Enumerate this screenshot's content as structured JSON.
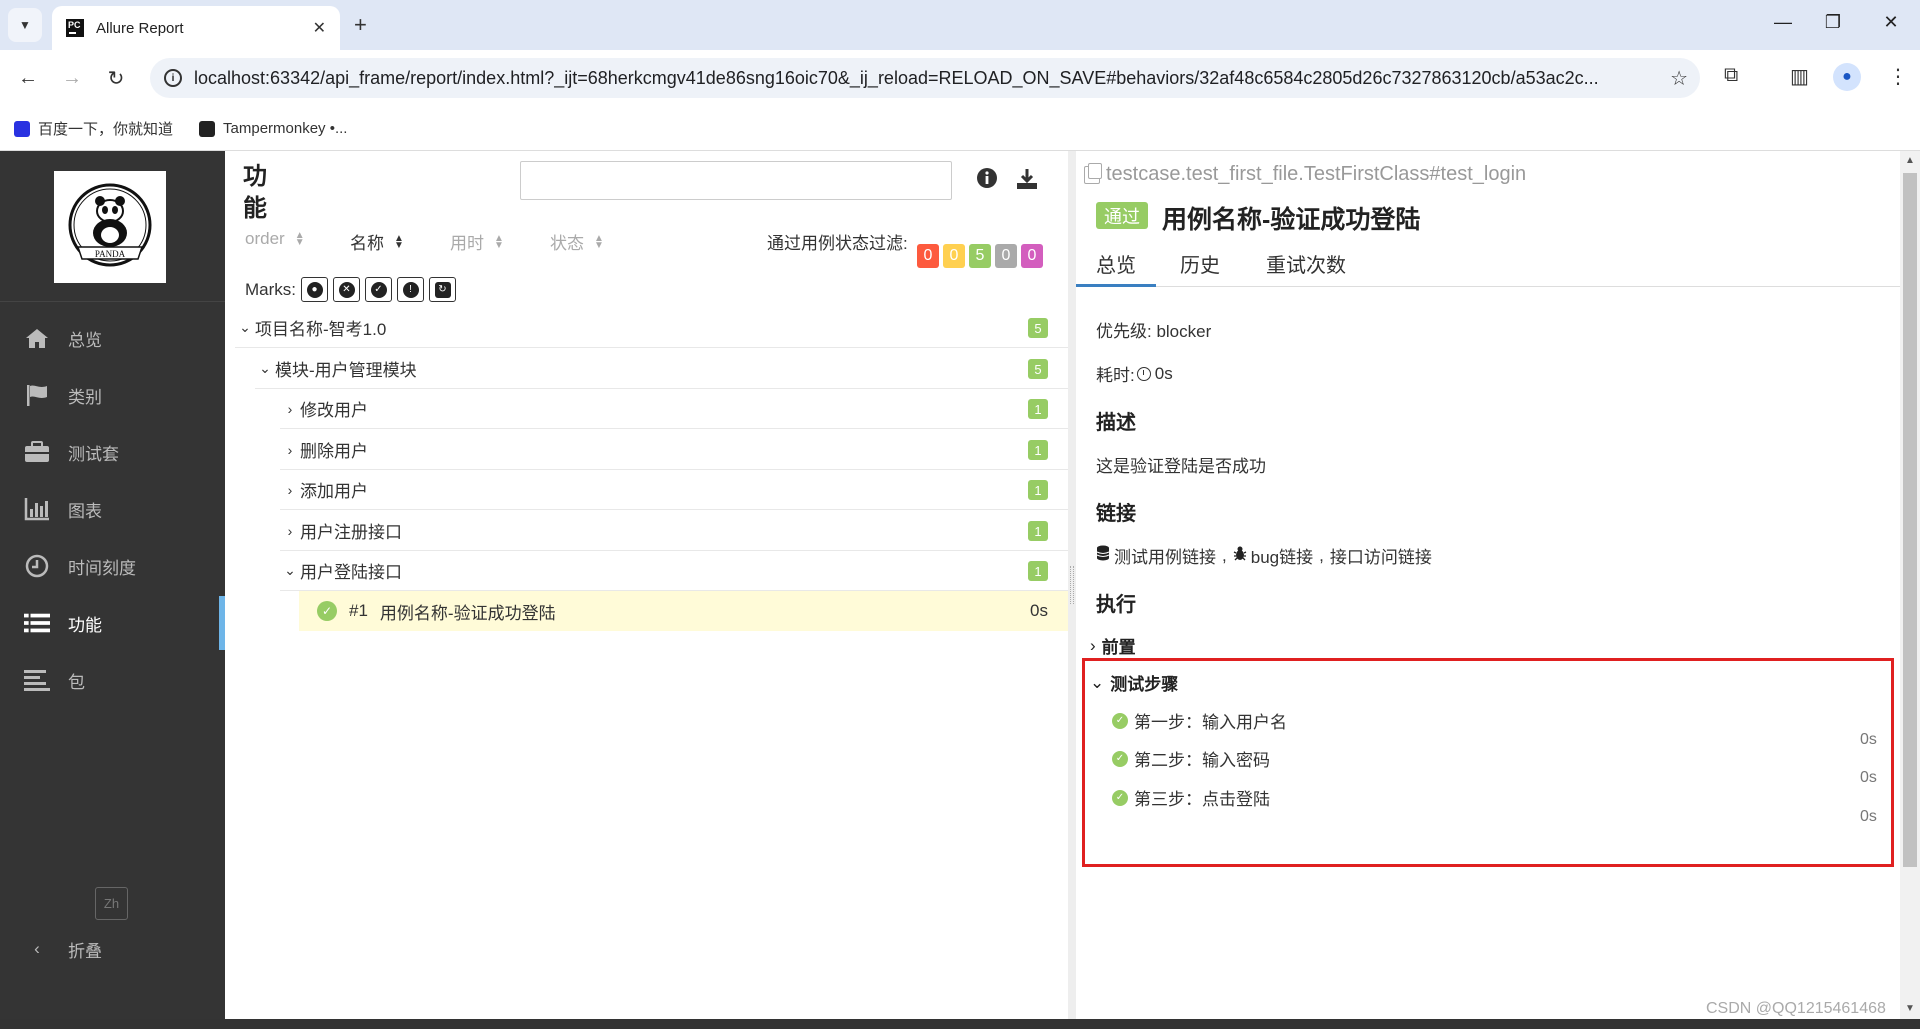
{
  "browser": {
    "tab_title": "Allure Report",
    "favicon_text": "PC",
    "url": "localhost:63342/api_frame/report/index.html?_ijt=68herkcmgv41de86sng16oic70&_ij_reload=RELOAD_ON_SAVE#behaviors/32af48c6584c2805d26c7327863120cb/a53ac2c...",
    "bookmarks": [
      "百度一下，你就知道",
      "Tampermonkey •..."
    ]
  },
  "sidebar": {
    "items": [
      {
        "label": "总览",
        "icon": "home-icon"
      },
      {
        "label": "类别",
        "icon": "flag-icon"
      },
      {
        "label": "测试套",
        "icon": "briefcase-icon"
      },
      {
        "label": "图表",
        "icon": "bar-chart-icon"
      },
      {
        "label": "时间刻度",
        "icon": "clock-icon"
      },
      {
        "label": "功能",
        "icon": "list-icon",
        "active": true
      },
      {
        "label": "包",
        "icon": "align-left-icon"
      }
    ],
    "lang": "Zh",
    "collapse_label": "折叠",
    "logo_text": "PANDA"
  },
  "tree": {
    "title": "功能",
    "sort_columns": [
      "order",
      "名称",
      "用时",
      "状态"
    ],
    "filter_label": "通过用例状态过滤:",
    "status_counts": [
      {
        "value": "0",
        "color": "#fd5a3e"
      },
      {
        "value": "0",
        "color": "#ffd050"
      },
      {
        "value": "5",
        "color": "#97cc64"
      },
      {
        "value": "0",
        "color": "#aaaaaa"
      },
      {
        "value": "0",
        "color": "#d35ebe"
      }
    ],
    "marks_label": "Marks:",
    "rows": [
      {
        "label": "项目名称-智考1.0",
        "count": "5"
      },
      {
        "label": "模块-用户管理模块",
        "count": "5"
      },
      {
        "label": "修改用户",
        "count": "1"
      },
      {
        "label": "删除用户",
        "count": "1"
      },
      {
        "label": "添加用户",
        "count": "1"
      },
      {
        "label": "用户注册接口",
        "count": "1"
      },
      {
        "label": "用户登陆接口",
        "count": "1"
      }
    ],
    "leaf": {
      "index": "#1",
      "name": "用例名称-验证成功登陆",
      "duration": "0s"
    }
  },
  "detail": {
    "path": "testcase.test_first_file.TestFirstClass#test_login",
    "status": "通过",
    "title": "用例名称-验证成功登陆",
    "tabs": [
      "总览",
      "历史",
      "重试次数"
    ],
    "severity": "优先级: blocker",
    "duration_label": "耗时:",
    "duration_value": "0s",
    "description_heading": "描述",
    "description": "这是验证登陆是否成功",
    "links_heading": "链接",
    "links": [
      "测试用例链接",
      "bug链接",
      "接口访问链接"
    ],
    "execution_heading": "执行",
    "setup_label": "前置",
    "steps_label": "测试步骤",
    "steps": [
      {
        "name": "第一步：输入用户名",
        "duration": "0s"
      },
      {
        "name": "第二步：输入密码",
        "duration": "0s"
      },
      {
        "name": "第三步：点击登陆",
        "duration": "0s"
      }
    ]
  },
  "watermark": "CSDN @QQ1215461468"
}
